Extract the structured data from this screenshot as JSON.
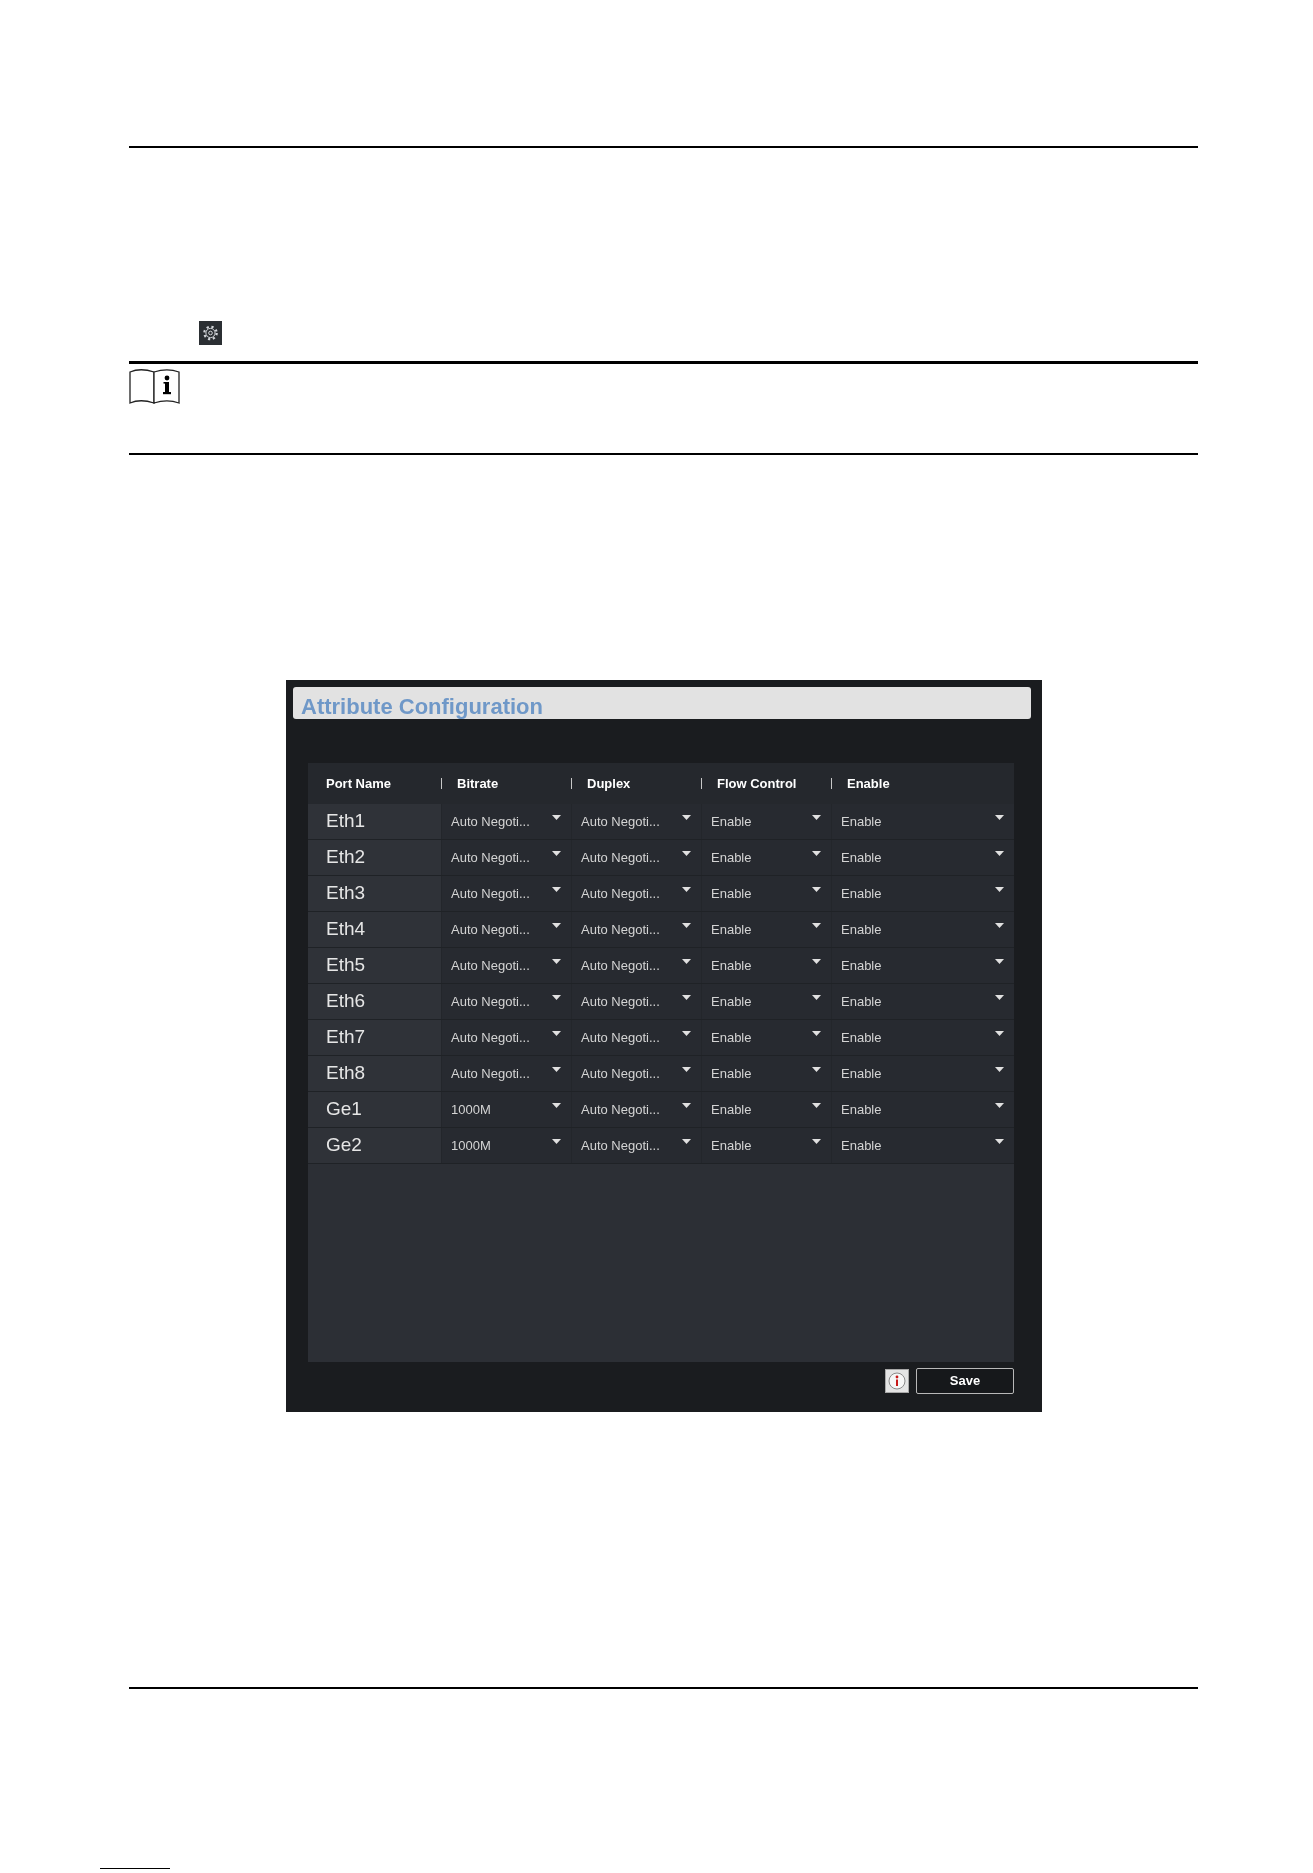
{
  "panel": {
    "title": "Attribute Configuration"
  },
  "table": {
    "columns": [
      "Port Name",
      "Bitrate",
      "Duplex",
      "Flow Control",
      "Enable"
    ],
    "rows": [
      {
        "port": "Eth1",
        "values": [
          "Auto Negoti...",
          "Auto Negoti...",
          "Enable",
          "Enable"
        ]
      },
      {
        "port": "Eth2",
        "values": [
          "Auto Negoti...",
          "Auto Negoti...",
          "Enable",
          "Enable"
        ]
      },
      {
        "port": "Eth3",
        "values": [
          "Auto Negoti...",
          "Auto Negoti...",
          "Enable",
          "Enable"
        ]
      },
      {
        "port": "Eth4",
        "values": [
          "Auto Negoti...",
          "Auto Negoti...",
          "Enable",
          "Enable"
        ]
      },
      {
        "port": "Eth5",
        "values": [
          "Auto Negoti...",
          "Auto Negoti...",
          "Enable",
          "Enable"
        ]
      },
      {
        "port": "Eth6",
        "values": [
          "Auto Negoti...",
          "Auto Negoti...",
          "Enable",
          "Enable"
        ]
      },
      {
        "port": "Eth7",
        "values": [
          "Auto Negoti...",
          "Auto Negoti...",
          "Enable",
          "Enable"
        ]
      },
      {
        "port": "Eth8",
        "values": [
          "Auto Negoti...",
          "Auto Negoti...",
          "Enable",
          "Enable"
        ]
      },
      {
        "port": "Ge1",
        "values": [
          "1000M",
          "Auto Negoti...",
          "Enable",
          "Enable"
        ]
      },
      {
        "port": "Ge2",
        "values": [
          "1000M",
          "Auto Negoti...",
          "Enable",
          "Enable"
        ]
      }
    ]
  },
  "buttons": [
    {
      "label": "Save"
    }
  ]
}
